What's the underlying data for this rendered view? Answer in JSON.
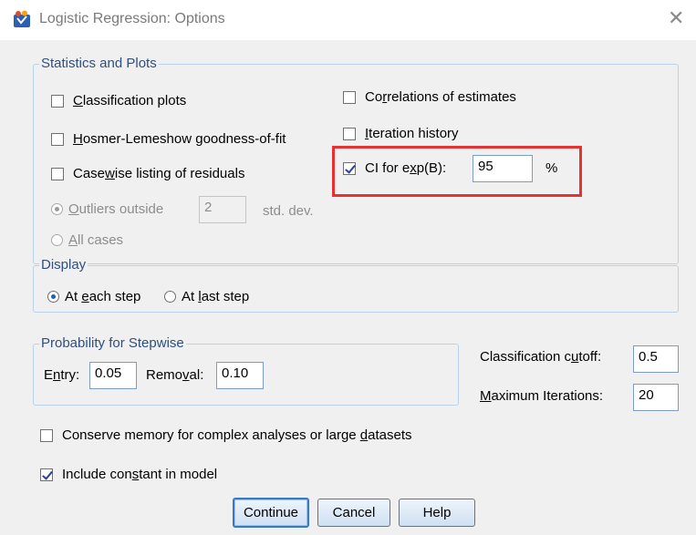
{
  "window": {
    "title": "Logistic Regression: Options"
  },
  "stats_group": {
    "title": "Statistics and Plots",
    "classification_plots": {
      "label_pre": "",
      "label_key": "C",
      "label_post": "lassification plots",
      "checked": false
    },
    "hosmer": {
      "label_pre": "",
      "label_key": "H",
      "label_post": "osmer-Lemeshow goodness-of-fit",
      "checked": false
    },
    "casewise": {
      "label_pre": "Case",
      "label_key": "w",
      "label_post": "ise listing of residuals",
      "checked": false
    },
    "outliers": {
      "label_pre": "",
      "label_key": "O",
      "label_post": "utliers outside",
      "value": "2",
      "unit": "std. dev.",
      "selected": true
    },
    "all_cases": {
      "label_pre": "",
      "label_key": "A",
      "label_post": "ll cases",
      "selected": false
    },
    "correlations": {
      "label_pre": "Co",
      "label_key": "r",
      "label_post": "relations of estimates",
      "checked": false
    },
    "iteration_history": {
      "label_pre": "",
      "label_key": "I",
      "label_post": "teration history",
      "checked": false
    },
    "ci": {
      "label_pre": "CI for e",
      "label_key": "x",
      "label_post": "p(B):",
      "value": "95",
      "unit": "%",
      "checked": true
    }
  },
  "display_group": {
    "title": "Display",
    "each_step": {
      "label_pre": "At ",
      "label_key": "e",
      "label_post": "ach step",
      "selected": true
    },
    "last_step": {
      "label_pre": "At ",
      "label_key": "l",
      "label_post": "ast step",
      "selected": false
    }
  },
  "stepwise_group": {
    "title": "Probability for Stepwise",
    "entry": {
      "label_pre": "E",
      "label_key": "n",
      "label_post": "try:",
      "value": "0.05"
    },
    "removal": {
      "label_pre": "Remo",
      "label_key": "v",
      "label_post": "al:",
      "value": "0.10"
    }
  },
  "cutoff": {
    "label_pre": "Classification c",
    "label_key": "u",
    "label_post": "toff:",
    "value": "0.5"
  },
  "max_iter": {
    "label_pre": "",
    "label_key": "M",
    "label_post": "aximum Iterations:",
    "value": "20"
  },
  "conserve": {
    "label_pre": "Conserve memory for complex analyses or large ",
    "label_key": "d",
    "label_post": "atasets",
    "checked": false
  },
  "include_constant": {
    "label_pre": "Include con",
    "label_key": "s",
    "label_post": "tant in model",
    "checked": true
  },
  "buttons": {
    "continue": "Continue",
    "cancel": "Cancel",
    "help": "Help"
  },
  "colors": {
    "accent_border": "#3b78c4",
    "highlight": "#e53333",
    "group_title": "#2f4f80"
  }
}
